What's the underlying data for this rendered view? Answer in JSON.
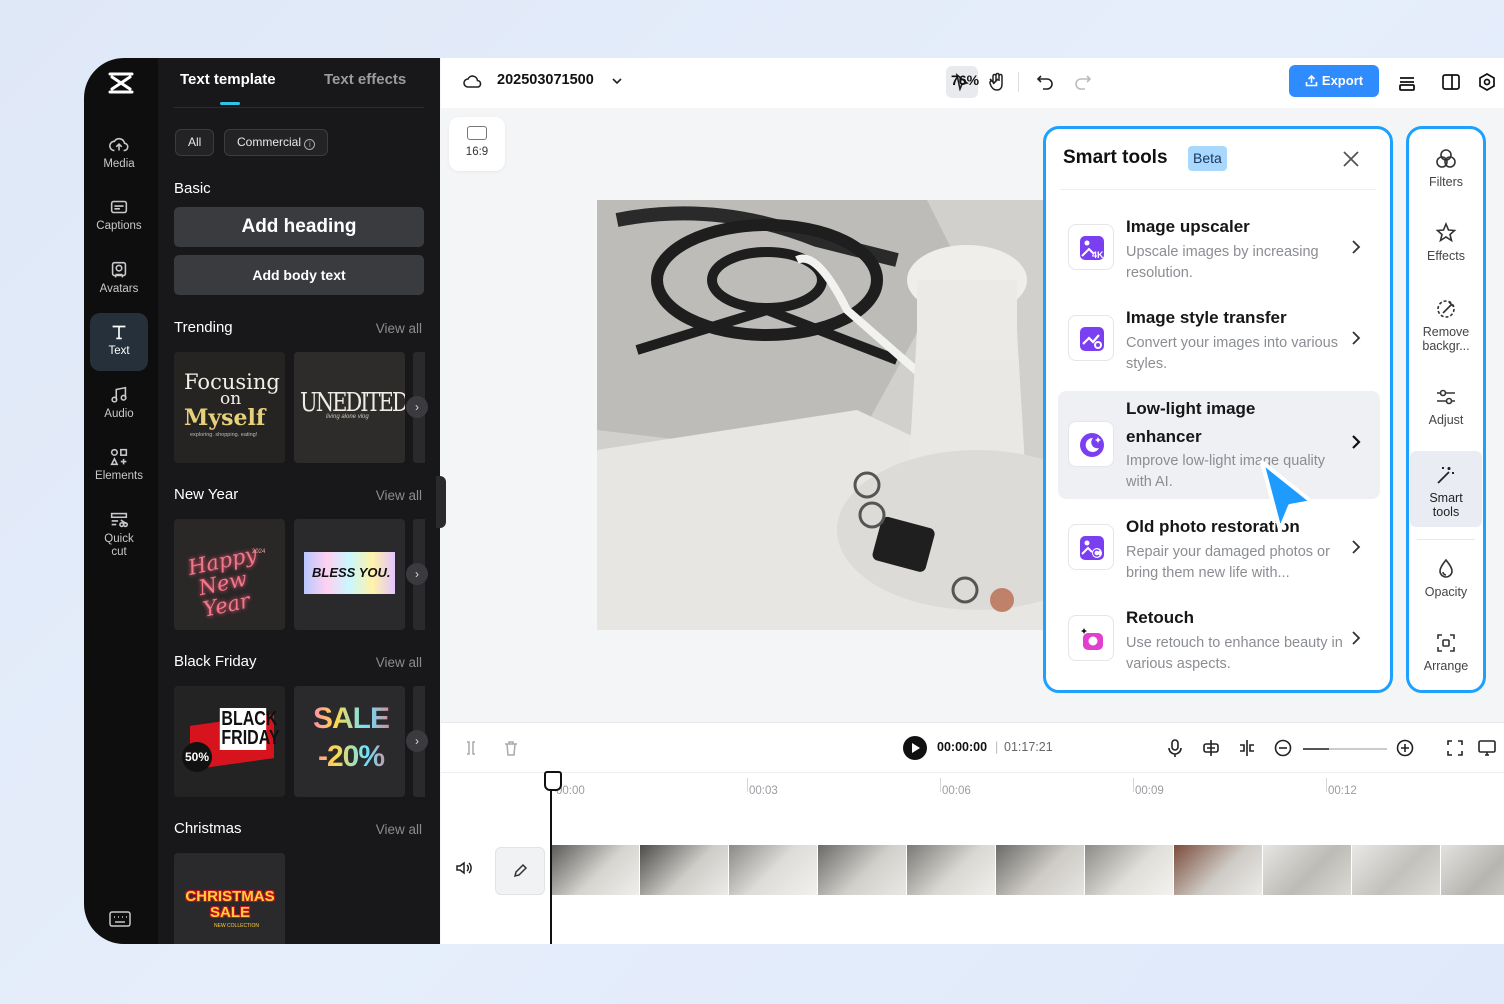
{
  "rail": {
    "items": [
      {
        "label": "Media",
        "icon": "media-cloud-icon"
      },
      {
        "label": "Captions",
        "icon": "captions-icon"
      },
      {
        "label": "Avatars",
        "icon": "avatar-icon"
      },
      {
        "label": "Text",
        "icon": "text-icon"
      },
      {
        "label": "Audio",
        "icon": "music-note-icon"
      },
      {
        "label": "Elements",
        "icon": "elements-icon"
      },
      {
        "label": "Quick cut",
        "icon": "quick-cut-icon"
      }
    ]
  },
  "panel": {
    "tabs": [
      "Text template",
      "Text effects"
    ],
    "filters": [
      "All",
      "Commercial"
    ],
    "basic": {
      "title": "Basic",
      "add_heading": "Add heading",
      "add_body": "Add body text"
    },
    "sections": [
      {
        "title": "Trending",
        "view_all": "View all",
        "thumbs": [
          "Focusing on Myself",
          "UNEDITEDDAY"
        ]
      },
      {
        "title": "New Year",
        "view_all": "View all",
        "thumbs": [
          "Happy New Year",
          "BLESS YOU."
        ]
      },
      {
        "title": "Black Friday",
        "view_all": "View all",
        "thumbs": [
          "BLACK FRIDAY",
          "SALE -20%"
        ]
      },
      {
        "title": "Christmas",
        "view_all": "View all",
        "thumbs": [
          "CHRISTMAS SALE"
        ]
      }
    ],
    "thumb_sub": {
      "myself": "exploring. shopping. eating!",
      "unedited": "living alone vlog",
      "ny_year": "2024",
      "bf_pct": "50%",
      "xmas_sub": "NEW COLLECTION"
    }
  },
  "topbar": {
    "project_name": "202503071500",
    "zoom": "76%",
    "export_label": "Export"
  },
  "canvas": {
    "ratio_label": "16:9"
  },
  "smart_tools": {
    "title": "Smart tools",
    "badge": "Beta",
    "items": [
      {
        "name": "Image upscaler",
        "desc": "Upscale images by increasing resolution.",
        "icon": "upscale-4k-icon"
      },
      {
        "name": "Image style transfer",
        "desc": "Convert your images into various styles.",
        "icon": "style-transfer-icon"
      },
      {
        "name": "Low-light image enhancer",
        "desc": "Improve low-light image quality with AI.",
        "icon": "moon-sparkle-icon"
      },
      {
        "name": "Old photo restoration",
        "desc": "Repair your damaged photos or bring them new life with...",
        "icon": "photo-restore-icon"
      },
      {
        "name": "Retouch",
        "desc": "Use retouch to enhance beauty in various aspects.",
        "icon": "retouch-icon"
      }
    ]
  },
  "right_tools": [
    {
      "label": "Filters",
      "icon": "filters-icon"
    },
    {
      "label": "Effects",
      "icon": "effects-star-icon"
    },
    {
      "label": "Remove backgr...",
      "icon": "remove-bg-icon"
    },
    {
      "label": "Adjust",
      "icon": "adjust-sliders-icon"
    },
    {
      "label": "Smart tools",
      "icon": "magic-wand-icon"
    },
    {
      "label": "Opacity",
      "icon": "opacity-drop-icon"
    },
    {
      "label": "Arrange",
      "icon": "arrange-icon"
    }
  ],
  "timeline": {
    "current": "00:00:00",
    "separator": "|",
    "total": "01:17:21",
    "ruler": [
      "00:00",
      "00:03",
      "00:06",
      "00:09",
      "00:12"
    ]
  },
  "colors": {
    "accent": "#1ea0ff",
    "export": "#2f8cff",
    "tool_purple": "#7b3ff2",
    "tool_pink": "#e23fd0"
  }
}
